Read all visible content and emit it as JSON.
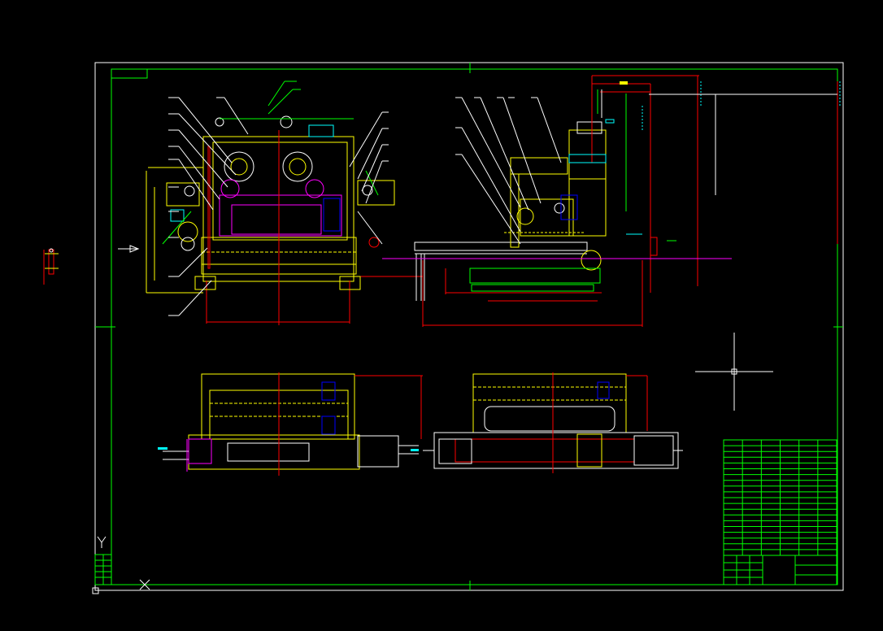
{
  "viewport": {
    "background": "#000000",
    "cursor_style": "crosshair"
  },
  "ucs_icon": {
    "y_label": "Y",
    "x_label": "X",
    "color": "#ffffff"
  },
  "colors": {
    "border_outer": "#ffffff",
    "border_inner": "#00ff00",
    "title_block": "#00ff00",
    "geometry_yellow": "#ffff00",
    "geometry_red": "#ff0000",
    "geometry_magenta": "#ff00ff",
    "geometry_cyan": "#00ffff",
    "geometry_blue": "#0000ff",
    "leader_white": "#ffffff"
  },
  "drawing": {
    "views": [
      {
        "name": "front-elevation-view"
      },
      {
        "name": "side-elevation-view"
      },
      {
        "name": "plan-view-left"
      },
      {
        "name": "plan-view-right"
      }
    ],
    "title_block": {
      "rows": 20,
      "columns": 6
    }
  }
}
